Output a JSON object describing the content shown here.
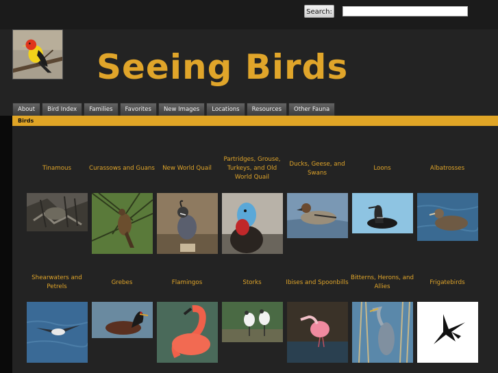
{
  "search": {
    "button_label": "Search:",
    "input_value": ""
  },
  "site": {
    "title": "Seeing Birds"
  },
  "nav": {
    "tabs": [
      "About",
      "Bird Index",
      "Families",
      "Favorites",
      "New Images",
      "Locations",
      "Resources",
      "Other Fauna"
    ]
  },
  "breadcrumb": {
    "label": "Birds"
  },
  "gallery": {
    "row1": [
      {
        "label": "Tinamous"
      },
      {
        "label": "Curassows and Guans"
      },
      {
        "label": "New World Quail"
      },
      {
        "label": "Partridges, Grouse, Turkeys, and Old World Quail"
      },
      {
        "label": "Ducks, Geese, and Swans"
      },
      {
        "label": "Loons"
      },
      {
        "label": "Albatrosses"
      }
    ],
    "row2": [
      {
        "label": "Shearwaters and Petrels"
      },
      {
        "label": "Grebes"
      },
      {
        "label": "Flamingos"
      },
      {
        "label": "Storks"
      },
      {
        "label": "Ibises and Spoonbills"
      },
      {
        "label": "Bitterns, Herons, and Allies"
      },
      {
        "label": "Frigatebirds"
      }
    ]
  },
  "colors": {
    "accent": "#e0a52a",
    "background": "#232323",
    "topbar": "#1b1b1b"
  }
}
